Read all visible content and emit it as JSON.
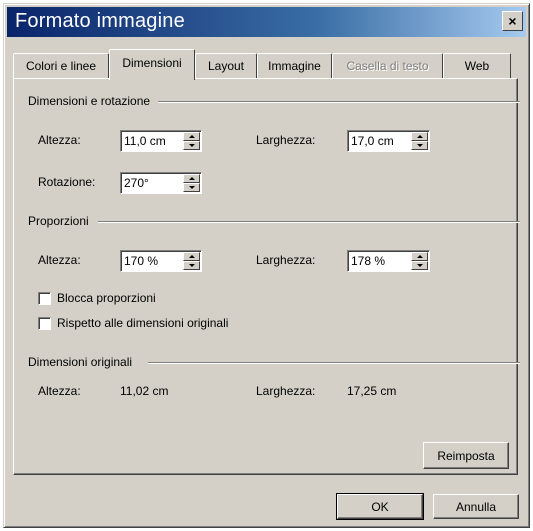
{
  "window": {
    "title": "Formato immagine",
    "close_glyph": "×"
  },
  "tabs": [
    {
      "label": "Colori e linee"
    },
    {
      "label": "Dimensioni"
    },
    {
      "label": "Layout"
    },
    {
      "label": "Immagine"
    },
    {
      "label": "Casella di testo"
    },
    {
      "label": "Web"
    }
  ],
  "size_rotation": {
    "section": "Dimensioni e rotazione",
    "height_label": "Altezza:",
    "height_value": "11,0 cm",
    "width_label": "Larghezza:",
    "width_value": "17,0 cm",
    "rotation_label": "Rotazione:",
    "rotation_value": "270°"
  },
  "scale": {
    "section": "Proporzioni",
    "height_label": "Altezza:",
    "height_value": "170 %",
    "width_label": "Larghezza:",
    "width_value": "178 %",
    "lock_label": "Blocca proporzioni",
    "lock_checked": false,
    "relative_label": "Rispetto alle dimensioni originali",
    "relative_checked": false
  },
  "original": {
    "section": "Dimensioni originali",
    "height_label": "Altezza:",
    "height_value": "11,02 cm",
    "width_label": "Larghezza:",
    "width_value": "17,25 cm"
  },
  "buttons": {
    "reset": "Reimposta",
    "ok": "OK",
    "cancel": "Annulla"
  },
  "colors": {
    "face": "#d4d0c8",
    "title_start": "#0a246a",
    "title_end": "#a6caf0"
  }
}
